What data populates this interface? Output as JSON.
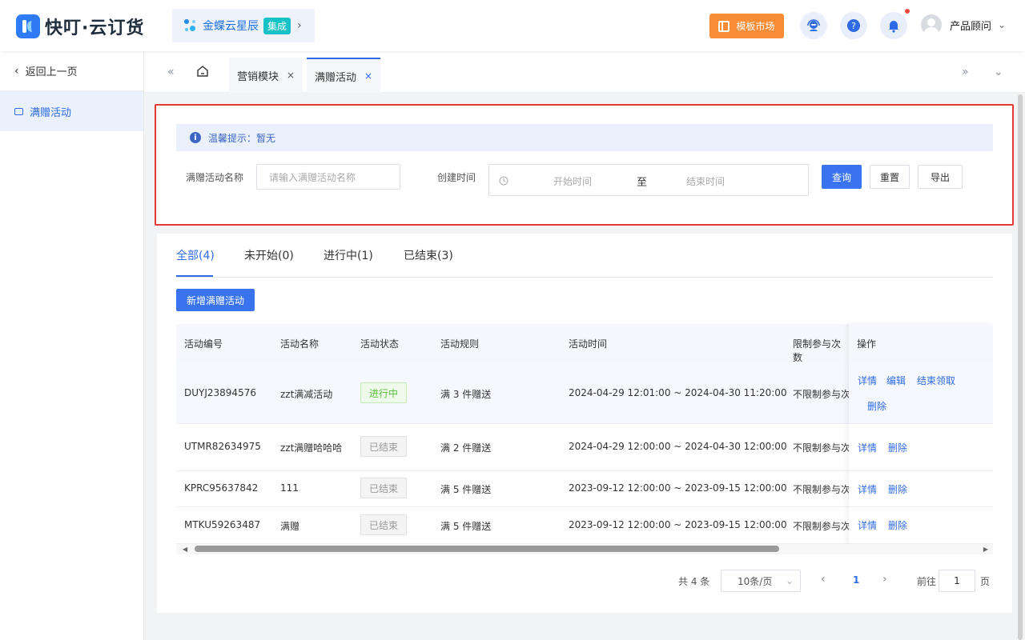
{
  "header": {
    "logo_text": "快叮·云订货",
    "brand_name": "金蝶云星辰",
    "brand_tag": "集成",
    "brand_arrow": "›",
    "market_label": "模板市场",
    "user_name": "产品顾问",
    "user_caret": "⌄"
  },
  "sidebar": {
    "back_label": "返回上一页",
    "items": [
      {
        "label": "满赠活动"
      }
    ]
  },
  "tabs": {
    "prev_icon": "«",
    "next_icon": "»",
    "more_icon": "⌄",
    "items": [
      {
        "label": "营销模块",
        "close": "×"
      },
      {
        "label": "满赠活动",
        "close": "×"
      }
    ]
  },
  "notice": {
    "icon": "i",
    "text": "温馨提示：暂无"
  },
  "filters": {
    "name_label": "满赠活动名称",
    "name_placeholder": "请输入满赠活动名称",
    "time_label": "创建时间",
    "start_placeholder": "开始时间",
    "range_sep": "至",
    "end_placeholder": "结束时间",
    "query_label": "查询",
    "reset_label": "重置",
    "export_label": "导出"
  },
  "status_tabs": [
    {
      "label": "全部(4)"
    },
    {
      "label": "未开始(0)"
    },
    {
      "label": "进行中(1)"
    },
    {
      "label": "已结束(3)"
    }
  ],
  "add_button_label": "新增满赠活动",
  "table": {
    "columns": [
      "活动编号",
      "活动名称",
      "活动状态",
      "活动规则",
      "活动时间",
      "限制参与次数",
      "操作"
    ],
    "rows": [
      {
        "id": "DUYJ23894576",
        "name": "zzt满减活动",
        "status": "进行中",
        "rule": "满 3 件赠送",
        "time": "2024-04-29 12:01:00 ~ 2024-04-30 11:20:00",
        "limit": "不限制参与次数",
        "ops": [
          "详情",
          "编辑",
          "结束领取",
          "删除"
        ]
      },
      {
        "id": "UTMR82634975",
        "name": "zzt满赠哈哈哈",
        "status": "已结束",
        "rule": "满 2 件赠送",
        "time": "2024-04-29 12:00:00 ~ 2024-04-30 12:00:00",
        "limit": "不限制参与次数",
        "ops": [
          "详情",
          "删除"
        ]
      },
      {
        "id": "KPRC95637842",
        "name": "111",
        "status": "已结束",
        "rule": "满 5 件赠送",
        "time": "2023-09-12 12:00:00 ~ 2023-09-15 12:00:00",
        "limit": "不限制参与次数",
        "ops": [
          "详情",
          "删除"
        ]
      },
      {
        "id": "MTKU59263487",
        "name": "满赠",
        "status": "已结束",
        "rule": "满 5 件赠送",
        "time": "2023-09-12 12:00:00 ~ 2023-09-15 12:00:00",
        "limit": "不限制参与次数",
        "ops": [
          "详情",
          "删除"
        ]
      }
    ]
  },
  "pagination": {
    "total": "共 4 条",
    "page_size": "10条/页",
    "page": "1",
    "goto_label": "前往",
    "goto_value": "1",
    "page_suffix": "页"
  },
  "colors": {
    "primary": "#3a73ee",
    "market": "#fa8c35",
    "running": "#5cbe3c",
    "highlight_border": "#e53935"
  }
}
